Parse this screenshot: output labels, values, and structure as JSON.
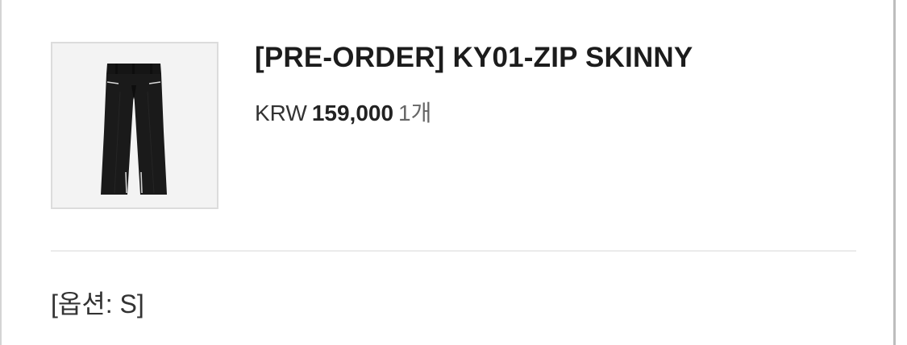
{
  "product": {
    "title": "[PRE-ORDER] KY01-ZIP SKINNY",
    "currency": "KRW",
    "price": "159,000",
    "quantity": "1개",
    "option": "[옵션: S]",
    "image_icon": "black-zip-skinny-jeans-image"
  },
  "colors": {
    "title": "#1c1c1c",
    "divider": "#ebebeb",
    "thumb_border": "#dcdcdc",
    "thumb_bg": "#f3f3f3"
  }
}
